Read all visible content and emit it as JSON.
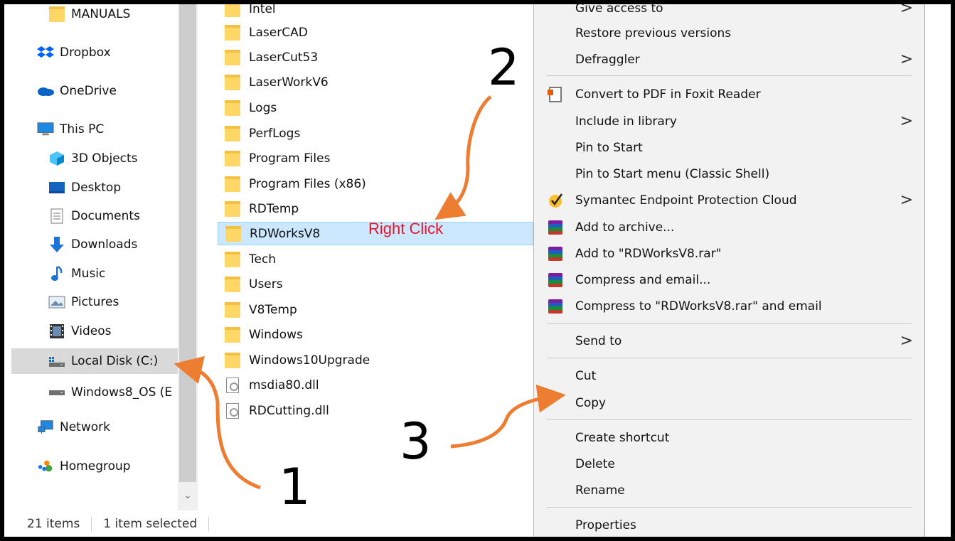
{
  "nav": {
    "items": [
      {
        "label": "MANUALS",
        "icon": "folder-icon"
      },
      {
        "label": "Dropbox",
        "icon": "dropbox-icon"
      },
      {
        "label": "OneDrive",
        "icon": "onedrive-icon"
      },
      {
        "label": "This PC",
        "icon": "this-pc-icon"
      },
      {
        "label": "3D Objects",
        "icon": "3d-objects-icon"
      },
      {
        "label": "Desktop",
        "icon": "desktop-icon"
      },
      {
        "label": "Documents",
        "icon": "documents-icon"
      },
      {
        "label": "Downloads",
        "icon": "downloads-icon"
      },
      {
        "label": "Music",
        "icon": "music-icon"
      },
      {
        "label": "Pictures",
        "icon": "pictures-icon"
      },
      {
        "label": "Videos",
        "icon": "videos-icon"
      },
      {
        "label": "Local Disk (C:)",
        "icon": "local-disk-icon"
      },
      {
        "label": "Windows8_OS (E",
        "icon": "drive-icon"
      },
      {
        "label": "Network",
        "icon": "network-icon"
      },
      {
        "label": "Homegroup",
        "icon": "homegroup-icon"
      }
    ],
    "selected": "Local Disk (C:)"
  },
  "files": {
    "items": [
      {
        "name": "Intel",
        "type": "folder"
      },
      {
        "name": "LaserCAD",
        "type": "folder"
      },
      {
        "name": "LaserCut53",
        "type": "folder"
      },
      {
        "name": "LaserWorkV6",
        "type": "folder"
      },
      {
        "name": "Logs",
        "type": "folder"
      },
      {
        "name": "PerfLogs",
        "type": "folder"
      },
      {
        "name": "Program Files",
        "type": "folder"
      },
      {
        "name": "Program Files (x86)",
        "type": "folder"
      },
      {
        "name": "RDTemp",
        "type": "folder"
      },
      {
        "name": "RDWorksV8",
        "type": "folder"
      },
      {
        "name": "Tech",
        "type": "folder"
      },
      {
        "name": "Users",
        "type": "folder"
      },
      {
        "name": "V8Temp",
        "type": "folder"
      },
      {
        "name": "Windows",
        "type": "folder"
      },
      {
        "name": "Windows10Upgrade",
        "type": "folder"
      },
      {
        "name": "msdia80.dll",
        "type": "dll"
      },
      {
        "name": "RDCutting.dll",
        "type": "dll"
      }
    ],
    "selected": "RDWorksV8"
  },
  "status": {
    "count": "21 items",
    "selection": "1 item selected"
  },
  "context_menu": {
    "items": [
      {
        "label": "Give access to",
        "submenu": true
      },
      {
        "label": "Restore previous versions"
      },
      {
        "label": "Defraggler",
        "submenu": true
      },
      {
        "label": "Convert to PDF in Foxit Reader",
        "icon": "foxit-pdf-icon"
      },
      {
        "label": "Include in library",
        "submenu": true
      },
      {
        "label": "Pin to Start"
      },
      {
        "label": "Pin to Start menu (Classic Shell)"
      },
      {
        "label": "Symantec Endpoint Protection Cloud",
        "icon": "symantec-check-icon",
        "submenu": true
      },
      {
        "label": "Add to archive...",
        "icon": "winrar-icon"
      },
      {
        "label": "Add to \"RDWorksV8.rar\"",
        "icon": "winrar-icon"
      },
      {
        "label": "Compress and email...",
        "icon": "winrar-icon"
      },
      {
        "label": "Compress to \"RDWorksV8.rar\" and email",
        "icon": "winrar-icon"
      },
      {
        "label": "Send to",
        "submenu": true
      },
      {
        "label": "Cut"
      },
      {
        "label": "Copy"
      },
      {
        "label": "Create shortcut"
      },
      {
        "label": "Delete"
      },
      {
        "label": "Rename"
      },
      {
        "label": "Properties"
      }
    ],
    "submenu_glyph": ">"
  },
  "annotations": {
    "step1": "1",
    "step2": "2",
    "step3": "3",
    "right_click_label": "Right Click",
    "arrow_color": "#ed7d31",
    "label_color": "#e5142b"
  }
}
